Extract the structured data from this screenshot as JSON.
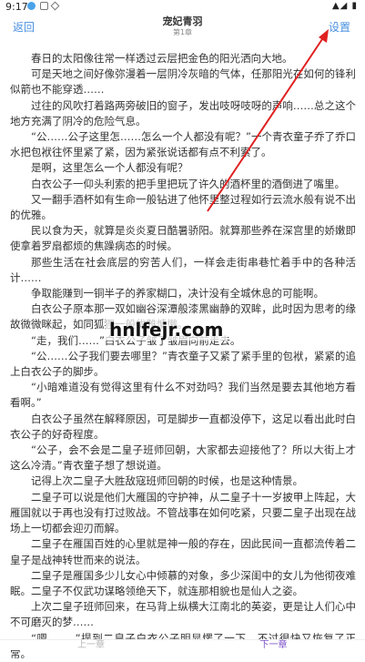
{
  "status_bar": {
    "time": "9:17",
    "right": "▲◢ ▮"
  },
  "header": {
    "back": "返回",
    "title": "宠妃青羽",
    "chapter": "第1章",
    "settings": "设置"
  },
  "paragraphs": [
    "春日的太阳像往常一样透过云层把金色的阳光洒向大地。",
    "可是天地之间好像弥漫着一层阴冷灰暗的气体，任那阳光在如何的锋利似箭也不能穿透……",
    "过往的风吹打着路两旁破旧的窗子，发出吱呀吱呀的声响……总之这个地方充满了阴冷的危险气息。",
    "“公……公子这里怎……怎么一个人都没有呢？”一个青衣童子乔了乔口水把包袱往怀里紧了紧，因为紧张说话都有点不利索了。",
    "是啊，这里怎么一个人都没有呢？",
    "白衣公子一仰头利索的把手里把玩了许久的酒杯里的酒倒进了嘴里。",
    "又一翻手酒杯如有生命一般钻进了他怀里整过程如行云流水般有说不出的优雅。",
    "民以食为天，就算是炎炎夏日酷暑骄阳。就算那些养在深宫里的娇嫩即使拿着罗扇都烦的焦躁病态的时候。",
    "那些生活在社会底层的穷苦人们，一样会走街串巷忙着手中的各种活计……",
    "争取能赚到一铜半子的养家糊口，决计没有全城休息的可能啊。",
    "白衣公子原本那一双如幽谷深潭般漆黑幽静的双眸，此时因为思考的缘故微微眯起，如同狐狸一般优雅慵懒。",
    "“走，我们……”白衣公子皱了皱眉向前走去。",
    "“公……公子我们要去哪里？”青衣童子又紧了紧手里的包袱，紧紧的追上白衣公子的脚步。",
    "“小暗难道没有觉得这里有什么不对劲吗？我们当然是要去其他地方看看啊。”",
    "白衣公子虽然在解释原因，可是脚步一直都没停下，这足以看出此时白衣公子的好奇程度。",
    "“公子，会不会是二皇子班师回朝，大家都去迎接他了？所以大街上才这么冷清。”青衣童子想了想说道。",
    "记得上次二皇子大胜敌寇班师回朝的时候，也是这种情景。",
    "二皇子可以说是他们大雁国的守护神，从二皇子十一岁披甲上阵起，大雁国就以于再也没有打过败战。不管战事在如何吃紧，只要二皇子出现在战场上一切都会迎刃而解。",
    "二皇子在雁国百姓的心里就是神一般的存在，因此民间一直都流传着二皇子是战神转世而来的说法。",
    "二皇子是雁国多少儿女心中倾慕的对象，多少深闺中的女儿为他彻夜难眠。二皇子不仅武功谋略领绝天下，就连那相貌也是仙人之姿。",
    "上次二皇子班师回来，在马背上纵横大江南北的英姿，更是让人们心中不可磨灭的梦……",
    "“嗯……，”提到二皇子白衣公子明显愣了一下，不过很快又恢复了正常。"
  ],
  "watermark": "hnlfejr.com",
  "footer": {
    "prev": "上一章",
    "next": "下一章"
  }
}
